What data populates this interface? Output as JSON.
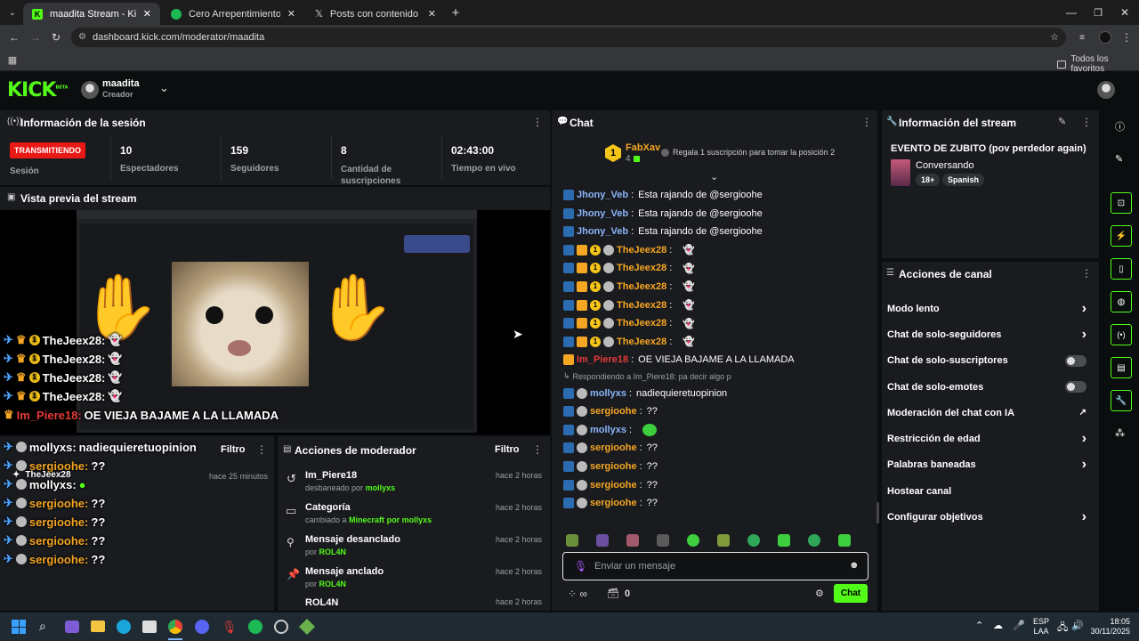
{
  "browser": {
    "tabs": [
      {
        "title": "maadita Stream - Kick Dashbo"
      },
      {
        "title": "Cero Arrepentimiento • TheDa"
      },
      {
        "title": "Posts con contenido multimed"
      }
    ],
    "url": "dashboard.kick.com/moderator/maadita",
    "bookmarks_label": "Todos los favoritos"
  },
  "header": {
    "logo": "KICK",
    "logo_beta": "BETA",
    "user_name": "maadita",
    "user_role": "Creador"
  },
  "session": {
    "title": "Información de la sesión",
    "status_badge": "TRANSMITIENDO",
    "status_label": "Sesión",
    "stats": [
      {
        "value": "10",
        "label": "Espectadores"
      },
      {
        "value": "159",
        "label": "Seguidores"
      },
      {
        "value": "8",
        "label": "Cantidad de suscripciones"
      },
      {
        "value": "02:43:00",
        "label": "Tiempo en vivo"
      }
    ]
  },
  "preview": {
    "title": "Vista previa del stream",
    "overlay_chat": [
      {
        "user": "TheJeex28:",
        "msg": ""
      },
      {
        "user": "TheJeex28:",
        "msg": ""
      },
      {
        "user": "TheJeex28:",
        "msg": ""
      },
      {
        "user": "TheJeex28:",
        "msg": ""
      },
      {
        "user": "Im_Piere18:",
        "msg": "OE VIEJA BAJAME A LA LLAMADA"
      },
      {
        "user": "mollyxs:",
        "msg": "nadiequieretuopinion"
      },
      {
        "user": "sergioohe:",
        "msg": "??"
      },
      {
        "user": "mollyxs:",
        "msg": ""
      },
      {
        "user": "sergioohe:",
        "msg": "??"
      },
      {
        "user": "sergioohe:",
        "msg": "??"
      },
      {
        "user": "sergioohe:",
        "msg": "??"
      },
      {
        "user": "sergioohe:",
        "msg": "??"
      }
    ],
    "float_user": "TheJeex28"
  },
  "left_lower": {
    "filter": "Filtro",
    "time": "hace 25 minutos"
  },
  "mod_actions": {
    "title": "Acciones de moderador",
    "filter": "Filtro",
    "items": [
      {
        "title": "Im_Piere18",
        "sub_a": "desbaneado por",
        "sub_b": "",
        "sub_c": "mollyxs",
        "time": "hace 2 horas"
      },
      {
        "title": "Categoría",
        "sub_a": "cambiado a",
        "sub_b": "Minecraft",
        "sub_c": "por mollyxs",
        "time": "hace 2 horas"
      },
      {
        "title": "Mensaje desanclado",
        "sub_a": "por",
        "sub_b": "",
        "sub_c": "ROL4N",
        "time": "hace 2 horas"
      },
      {
        "title": "Mensaje anclado",
        "sub_a": "por",
        "sub_b": "",
        "sub_c": "ROL4N",
        "time": "hace 2 horas"
      },
      {
        "title": "ROL4N",
        "sub_a": "",
        "sub_b": "",
        "sub_c": "",
        "time": "hace 2 horas"
      }
    ]
  },
  "chat": {
    "title": "Chat",
    "pinned_user": "FabXav",
    "pinned_rank": "1",
    "pinned_count": "4",
    "gift_text": "Regala 1 suscripción para tomar la posición 2",
    "messages": [
      {
        "user": "Jhony_Veb",
        "msg": "Esta rajando de @sergioohe",
        "color": "#8ab4f8"
      },
      {
        "user": "Jhony_Veb",
        "msg": "Esta rajando de @sergioohe",
        "color": "#8ab4f8"
      },
      {
        "user": "Jhony_Veb",
        "msg": "Esta rajando de @sergioohe",
        "color": "#8ab4f8"
      },
      {
        "user": "TheJeex28",
        "msg": "",
        "color": "#f5a623"
      },
      {
        "user": "TheJeex28",
        "msg": "",
        "color": "#f5a623"
      },
      {
        "user": "TheJeex28",
        "msg": "",
        "color": "#f5a623"
      },
      {
        "user": "TheJeex28",
        "msg": "",
        "color": "#f5a623"
      },
      {
        "user": "TheJeex28",
        "msg": "",
        "color": "#f5a623"
      },
      {
        "user": "TheJeex28",
        "msg": "",
        "color": "#f5a623"
      },
      {
        "user": "Im_Piere18",
        "msg": "OE VIEJA BAJAME A LA LLAMADA",
        "color": "#e53935"
      }
    ],
    "reply_text": "Respondiendo a Im_Piere18: pa decir algo p",
    "messages2": [
      {
        "user": "mollyxs",
        "msg": "nadiequieretuopinion",
        "color": "#8ab4f8"
      },
      {
        "user": "sergioohe",
        "msg": "??",
        "color": "#f5a623"
      },
      {
        "user": "mollyxs",
        "msg": "",
        "color": "#8ab4f8"
      },
      {
        "user": "sergioohe",
        "msg": "??",
        "color": "#f5a623"
      },
      {
        "user": "sergioohe",
        "msg": "??",
        "color": "#f5a623"
      },
      {
        "user": "sergioohe",
        "msg": "??",
        "color": "#f5a623"
      },
      {
        "user": "sergioohe",
        "msg": "??",
        "color": "#f5a623"
      }
    ],
    "input_placeholder": "Enviar un mensaje",
    "viewer_count": "0",
    "send_label": "Chat"
  },
  "stream_info": {
    "title": "Información del stream",
    "stream_title": "EVENTO DE ZUBITO (pov perdedor again)",
    "category": "Conversando",
    "tags": [
      "18+",
      "Spanish"
    ]
  },
  "channel_actions": {
    "title": "Acciones de canal",
    "items": [
      {
        "label": "Modo lento",
        "control": "chevron"
      },
      {
        "label": "Chat de solo-seguidores",
        "control": "chevron"
      },
      {
        "label": "Chat de solo-suscriptores",
        "control": "switch"
      },
      {
        "label": "Chat de solo-emotes",
        "control": "switch"
      },
      {
        "label": "Moderación del chat con IA",
        "control": "external"
      },
      {
        "label": "Restricción de edad",
        "control": "chevron"
      },
      {
        "label": "Palabras baneadas",
        "control": "chevron"
      },
      {
        "label": "Hostear canal",
        "control": "none"
      },
      {
        "label": "Configurar objetivos",
        "control": "chevron"
      }
    ]
  },
  "taskbar": {
    "lang": "ESP",
    "lang2": "LAA",
    "time": "18:05",
    "date": "30/11/2025"
  },
  "colors": {
    "accent": "#53fc18",
    "panel": "#191b1f",
    "live": "#e91916"
  }
}
